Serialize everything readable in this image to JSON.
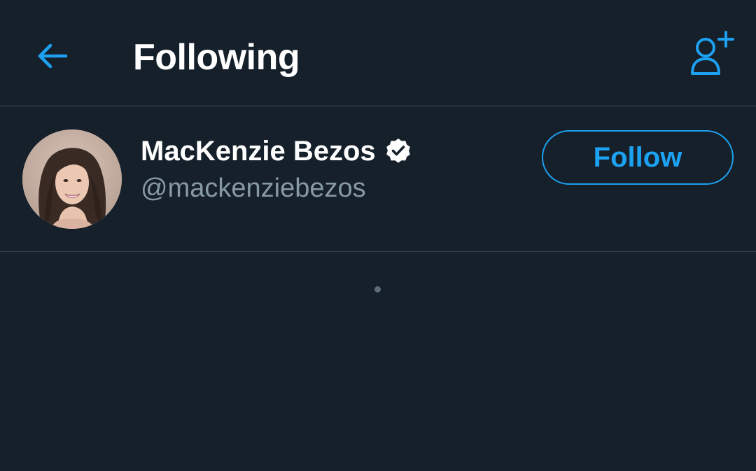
{
  "header": {
    "title": "Following",
    "back_icon": "arrow-left-icon",
    "add_user_icon": "add-user-icon"
  },
  "users": [
    {
      "display_name": "MacKenzie Bezos",
      "handle": "@mackenziebezos",
      "verified": true,
      "follow_label": "Follow"
    }
  ],
  "colors": {
    "background": "#15202b",
    "accent": "#1da1f2",
    "divider": "#38444d",
    "secondary_text": "#8899a6",
    "primary_text": "#ffffff"
  }
}
